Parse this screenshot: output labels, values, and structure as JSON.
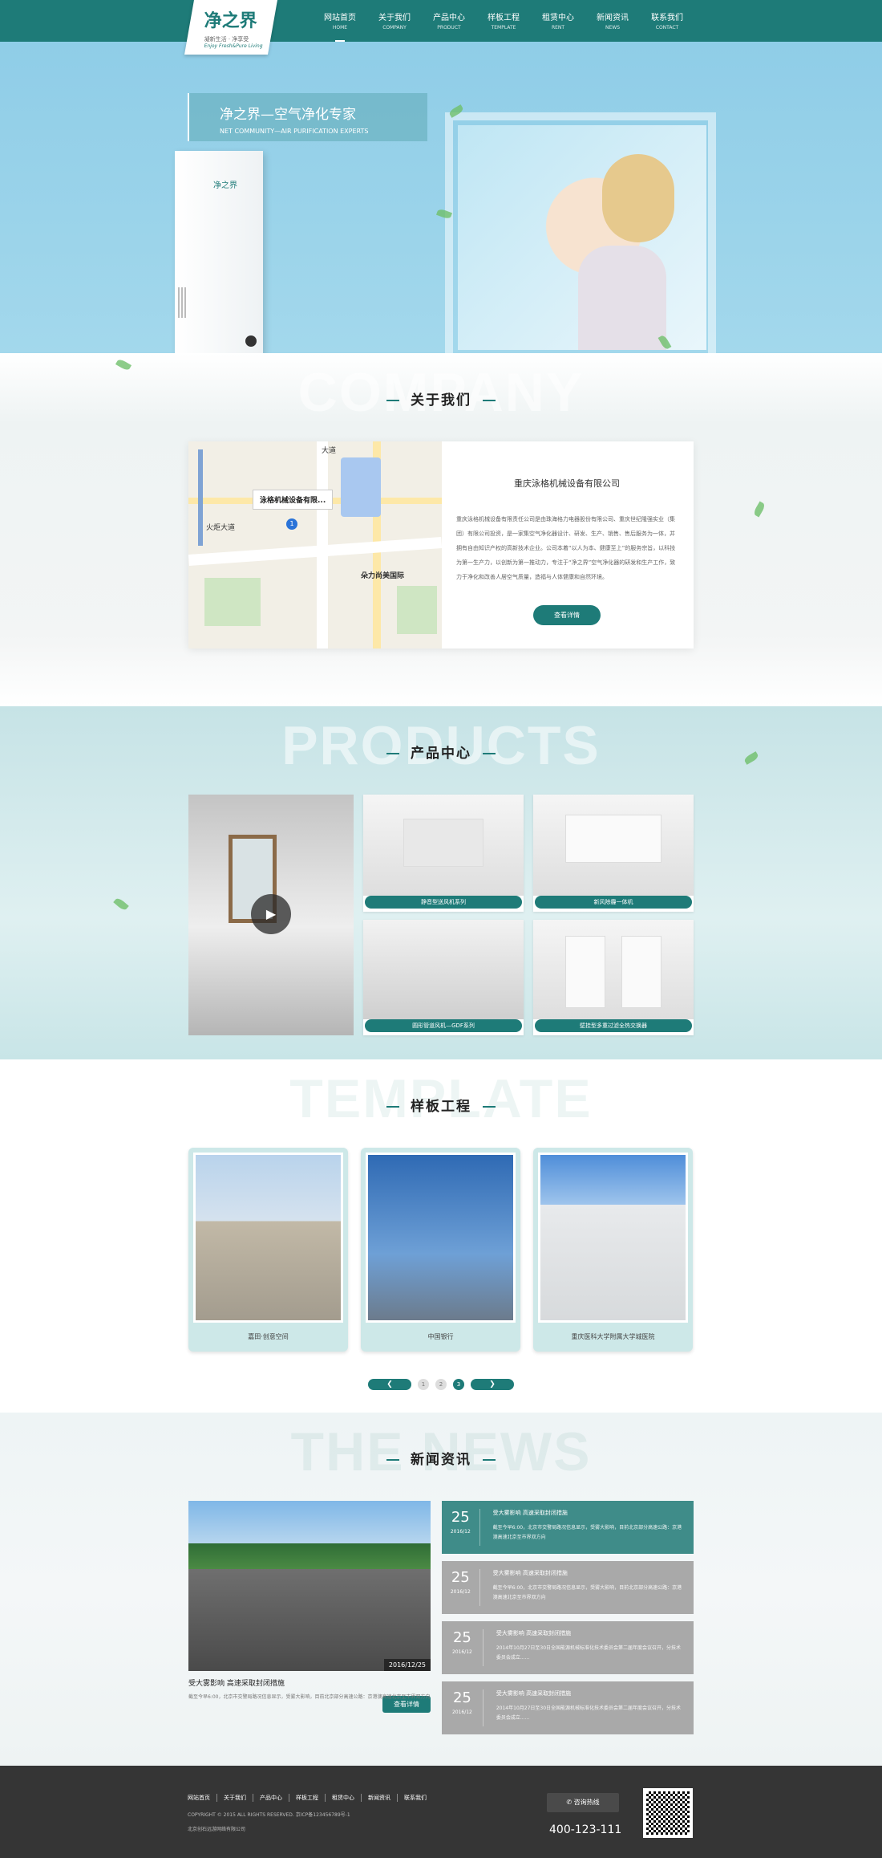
{
  "header": {
    "logo_mark": "净之界",
    "logo_slogan": "凝新生活 · 净享受",
    "logo_slogan_en": "Enjoy Fresh&Pure Living",
    "nav": [
      {
        "cn": "网站首页",
        "en": "HOME"
      },
      {
        "cn": "关于我们",
        "en": "COMPANY"
      },
      {
        "cn": "产品中心",
        "en": "PRODUCT"
      },
      {
        "cn": "样板工程",
        "en": "TEMPLATE"
      },
      {
        "cn": "租赁中心",
        "en": "RENT"
      },
      {
        "cn": "新闻资讯",
        "en": "NEWS"
      },
      {
        "cn": "联系我们",
        "en": "CONTACT"
      }
    ]
  },
  "banner": {
    "title": "净之界—空气净化专家",
    "subtitle": "NET COMMUNITY—AIR PURIFICATION EXPERTS",
    "device_brand": "净之界",
    "slides_count": 5,
    "active_slide": 3
  },
  "about": {
    "bg_text": "COMPANY",
    "title": "关于我们",
    "map_popup": "泳格机械设备有限...",
    "map_labels": [
      "火炬大道",
      "朵力尚美国际",
      "大道"
    ],
    "company_name": "重庆泳格机械设备有限公司",
    "description": "重庆泳格机械设备有限责任公司是由珠海格力电器股份有限公司、重庆世纪隆强实业（集团）有限公司投资，是一家集空气净化器设计、研发、生产、销售、售后服务为一体，并拥有自由知识产权的高新技术企业。公司本着“以人为本、健康至上”的服务宗旨，以科技为第一生产力，以创新为第一推动力，专注于“净之界”空气净化器的研发和生产工作，致力于净化和改善人居空气质量，造福与人体健康和自然环境。",
    "button": "查看详情"
  },
  "products": {
    "bg_text": "PRODUCTS",
    "title": "产品中心",
    "items": [
      "静音型送风机系列",
      "新风除霾一体机",
      "圆形管道风机—GDF系列",
      "壁挂型多重过滤全热交换器"
    ]
  },
  "template": {
    "bg_text": "TEMPLATE",
    "title": "样板工程",
    "items": [
      "嘉田·创意空间",
      "中国银行",
      "重庆医科大学附属大学城医院"
    ],
    "pages": [
      "1",
      "2",
      "3"
    ],
    "active_page": "3"
  },
  "news": {
    "bg_text": "THE NEWS",
    "title": "新闻资讯",
    "feature": {
      "date": "2016/12/25",
      "headline": "受大雾影响 高速采取封闭措施",
      "summary": "截至今早6:00，北京市交警局路况信息显示，受雾大影响，目前北京部分高速公路：京港澳高速北京至市界双方向",
      "button": "查看详情"
    },
    "items": [
      {
        "day": "25",
        "ym": "2016/12",
        "headline": "受大雾影响 高速采取封闭措施",
        "summary": "截至今早6:00，北京市交警局路况信息显示，受雾大影响，目前北京部分高速公路：京港澳高速北京至市界双方向"
      },
      {
        "day": "25",
        "ym": "2016/12",
        "headline": "受大雾影响 高速采取封闭措施",
        "summary": "截至今早6:00，北京市交警局路况信息显示，受雾大影响，目前北京部分高速公路：京港澳高速北京至市界双方向"
      },
      {
        "day": "25",
        "ym": "2016/12",
        "headline": "受大雾影响 高速采取封闭措施",
        "summary": "2014年10月27日至30日全国能源机械标准化技术委员会第二届年度会议召开，分技术委员会成立......"
      },
      {
        "day": "25",
        "ym": "2016/12",
        "headline": "受大雾影响 高速采取封闭措施",
        "summary": "2014年10月27日至30日全国能源机械标准化技术委员会第二届年度会议召开，分技术委员会成立......"
      }
    ]
  },
  "footer": {
    "links": [
      "网站首页",
      "关于我们",
      "产品中心",
      "样板工程",
      "租赁中心",
      "新闻资讯",
      "联系我们"
    ],
    "copyright": "COPYRIGHT © 2015 ALL RIGHTS RESERVED. 京ICP备123456789号-1",
    "company": "北京创石远游网络有限公司",
    "hotline_label": "咨询热线",
    "phone": "400-123-111"
  },
  "colors": {
    "primary": "#1e7b78",
    "banner": "#8fcde7",
    "footer": "#353535"
  }
}
